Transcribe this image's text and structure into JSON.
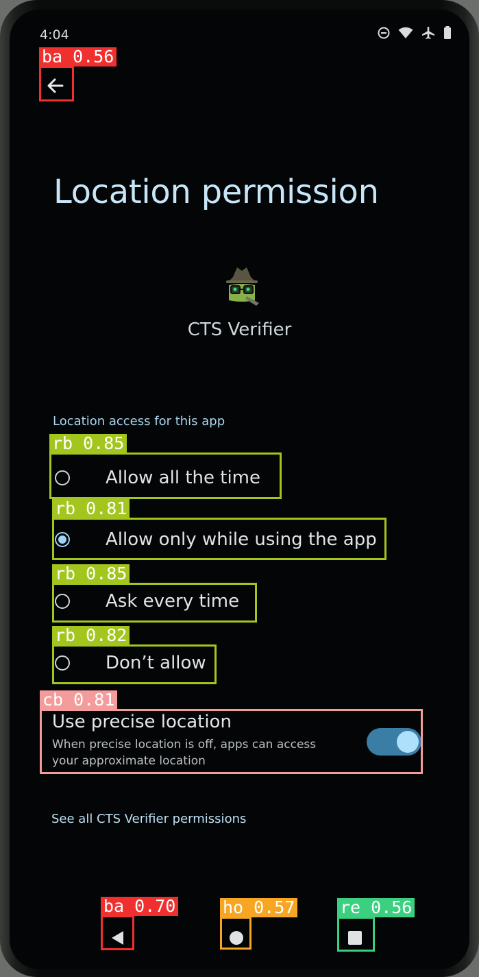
{
  "status_bar": {
    "time": "4:04",
    "icons": [
      "do-not-disturb-icon",
      "wifi-icon",
      "airplane-icon",
      "battery-icon"
    ]
  },
  "header": {
    "back_icon": "arrow-left-icon",
    "title": "Location permission"
  },
  "app": {
    "icon": "cts-verifier-android-icon",
    "name": "CTS Verifier"
  },
  "section_label": "Location access for this app",
  "options": [
    {
      "label": "Allow all the time",
      "checked": false
    },
    {
      "label": "Allow only while using the app",
      "checked": true
    },
    {
      "label": "Ask every time",
      "checked": false
    },
    {
      "label": "Don’t allow",
      "checked": false
    }
  ],
  "precise_location": {
    "title": "Use precise location",
    "description": "When precise location is off, apps can access your approximate location",
    "enabled": true
  },
  "see_all_link": "See all CTS Verifier permissions",
  "nav_bar": {
    "back_icon": "triangle-back-icon",
    "home_icon": "circle-home-icon",
    "recents_icon": "square-recents-icon"
  },
  "detections": [
    {
      "label": "ba 0.56",
      "color": "#f0302f"
    },
    {
      "label": "rb 0.85",
      "color": "#a3c61f"
    },
    {
      "label": "rb 0.81",
      "color": "#a3c61f"
    },
    {
      "label": "rb 0.85",
      "color": "#a3c61f"
    },
    {
      "label": "rb 0.82",
      "color": "#a3c61f"
    },
    {
      "label": "cb 0.81",
      "color": "#f49b9b"
    },
    {
      "label": "ba 0.70",
      "color": "#f0302f"
    },
    {
      "label": "ho 0.57",
      "color": "#f6a623"
    },
    {
      "label": "re 0.56",
      "color": "#3bcf80"
    }
  ]
}
